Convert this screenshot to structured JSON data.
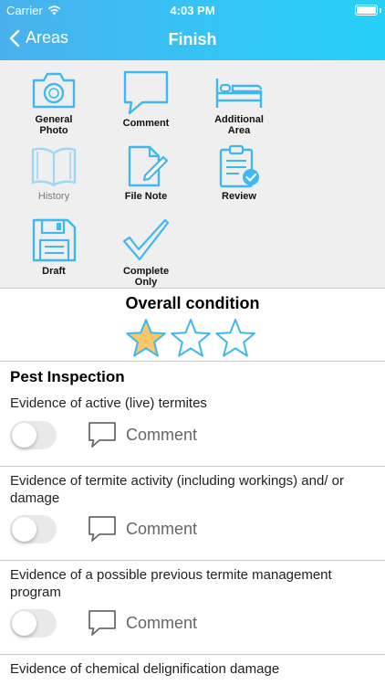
{
  "status_bar": {
    "carrier": "Carrier",
    "time": "4:03 PM"
  },
  "nav": {
    "back_label": "Areas",
    "title": "Finish"
  },
  "tools": [
    {
      "label_line1": "General",
      "label_line2": "Photo",
      "icon": "camera-icon"
    },
    {
      "label_line1": "Comment",
      "label_line2": "",
      "icon": "speech-bubble-icon"
    },
    {
      "label_line1": "Additional",
      "label_line2": "Area",
      "icon": "bed-icon"
    },
    {
      "label_line1": "History",
      "label_line2": "",
      "icon": "open-book-icon",
      "disabled": true
    },
    {
      "label_line1": "File Note",
      "label_line2": "",
      "icon": "document-pencil-icon"
    },
    {
      "label_line1": "Review",
      "label_line2": "",
      "icon": "clipboard-check-icon"
    },
    {
      "label_line1": "Draft",
      "label_line2": "",
      "icon": "floppy-disk-icon"
    },
    {
      "label_line1": "Complete",
      "label_line2": "Only",
      "icon": "checkmark-icon"
    }
  ],
  "condition": {
    "title": "Overall condition",
    "rating": 1,
    "max": 3
  },
  "section": {
    "title": "Pest Inspection"
  },
  "items": [
    {
      "title": "Evidence of active (live) termites",
      "toggle_on": false,
      "comment_label": "Comment"
    },
    {
      "title": "Evidence of termite activity (including workings) and/ or damage",
      "toggle_on": false,
      "comment_label": "Comment"
    },
    {
      "title": "Evidence of a possible previous termite management program",
      "toggle_on": false,
      "comment_label": "Comment"
    },
    {
      "title": "Evidence of chemical delignification damage"
    }
  ],
  "colors": {
    "header_start": "#4ab0ec",
    "header_end": "#25d0f7",
    "icon_blue": "#3fb8ef",
    "icon_disabled": "#9ed8f3",
    "star_fill": "#f7c76a",
    "star_outline": "#3fb8ef"
  }
}
